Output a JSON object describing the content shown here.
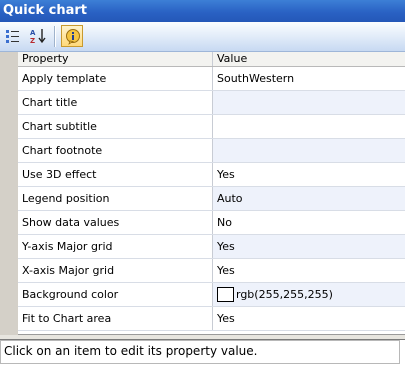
{
  "window": {
    "title": "Quick chart"
  },
  "toolbar": {
    "buttons": [
      {
        "icon": "categorized-icon",
        "tooltip": ""
      },
      {
        "icon": "sort-alphabetical-icon",
        "tooltip": ""
      },
      {
        "icon": "property-pages-icon",
        "tooltip": ""
      }
    ]
  },
  "grid": {
    "columns": [
      "Property",
      "Value"
    ],
    "rows": [
      {
        "property": "Apply template",
        "value": "SouthWestern"
      },
      {
        "property": "Chart title",
        "value": ""
      },
      {
        "property": "Chart subtitle",
        "value": ""
      },
      {
        "property": "Chart footnote",
        "value": ""
      },
      {
        "property": "Use 3D effect",
        "value": "Yes"
      },
      {
        "property": "Legend position",
        "value": "Auto"
      },
      {
        "property": "Show data values",
        "value": "No"
      },
      {
        "property": "Y-axis Major grid",
        "value": "Yes"
      },
      {
        "property": "X-axis Major grid",
        "value": "Yes"
      },
      {
        "property": "Background color",
        "value": "rgb(255,255,255)",
        "swatch": "#ffffff"
      },
      {
        "property": "Fit to Chart area",
        "value": "Yes"
      }
    ]
  },
  "description": {
    "text": "Click on an item to edit its property value."
  },
  "colors": {
    "title_bar": "#2a62c4",
    "toolbar": "#dfeaf8",
    "alt_row": "#eef2fb",
    "gutter": "#d4d0c8"
  }
}
